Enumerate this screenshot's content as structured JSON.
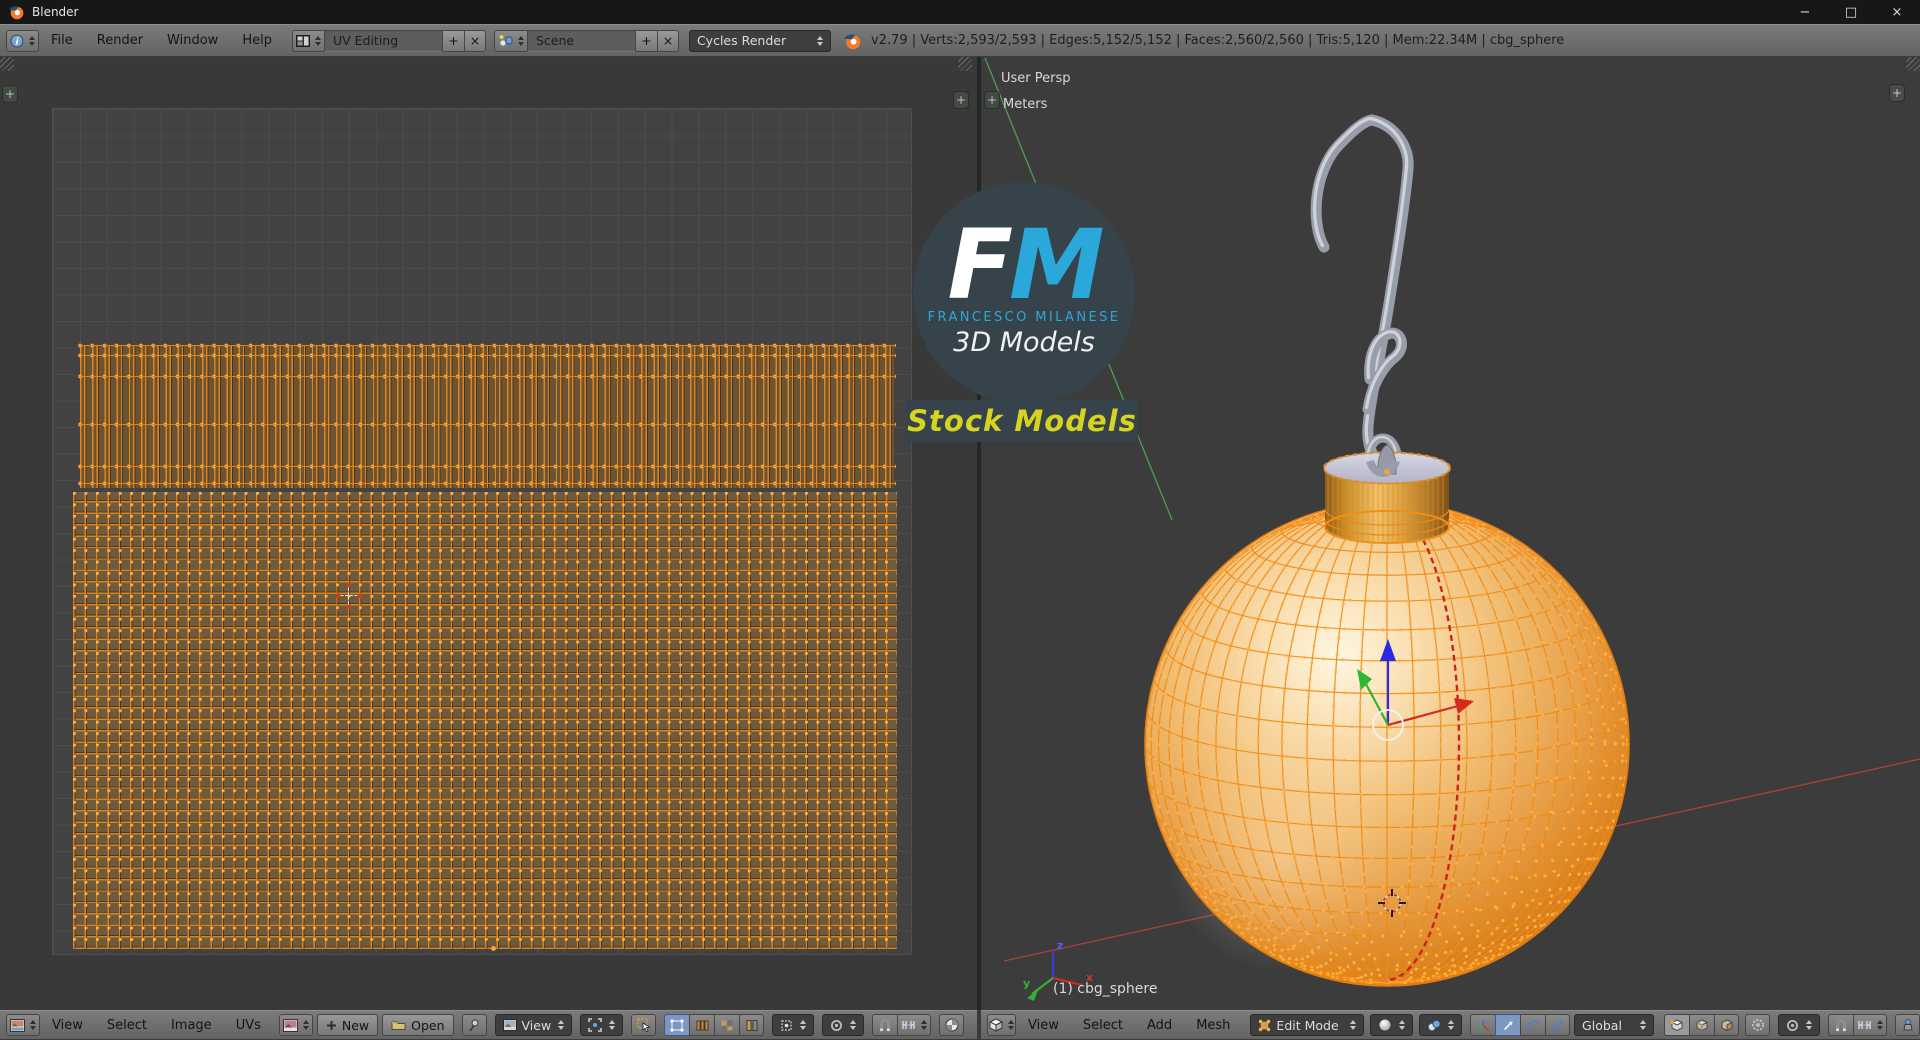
{
  "titlebar": {
    "title": "Blender",
    "minimize": "−",
    "maximize": "□",
    "close": "×"
  },
  "info_header": {
    "menus": [
      {
        "label": "File"
      },
      {
        "label": "Render"
      },
      {
        "label": "Window"
      },
      {
        "label": "Help"
      }
    ],
    "layout": {
      "value": "UV Editing"
    },
    "scene": {
      "value": "Scene"
    },
    "engine": {
      "value": "Cycles Render"
    },
    "stats": "v2.79 | Verts:2,593/2,593 | Edges:5,152/5,152 | Faces:2,560/2,560 | Tris:5,120 | Mem:22.34M | cbg_sphere"
  },
  "common": {
    "plus": "+",
    "close": "×"
  },
  "uv_editor": {
    "header": {
      "menus": [
        "View",
        "Select",
        "Image",
        "UVs"
      ],
      "new_button": "New",
      "open_button": "Open",
      "mode_menu": "View"
    }
  },
  "viewport_3d": {
    "overlay": {
      "view_name": "User Persp",
      "units": "Meters",
      "object_info": "(1) cbg_sphere"
    },
    "axis_labels": {
      "x": "x",
      "y": "y",
      "z": "z"
    },
    "header": {
      "menus": [
        "View",
        "Select",
        "Add",
        "Mesh"
      ],
      "mode": "Edit Mode",
      "orientation": "Global"
    }
  },
  "watermark": {
    "initial_f": "F",
    "initial_m": "M",
    "name": "FRANCESCO MILANESE",
    "tagline": "3D Models",
    "banner": "Stock Models"
  },
  "colors": {
    "wire_orange": "#f08a14",
    "vertex_dot": "#ffb04a",
    "logo_blue": "#2ba8da",
    "banner_yellow": "#d8d322",
    "seam_red": "#cf2318",
    "gold_mid": "#eeb566"
  }
}
